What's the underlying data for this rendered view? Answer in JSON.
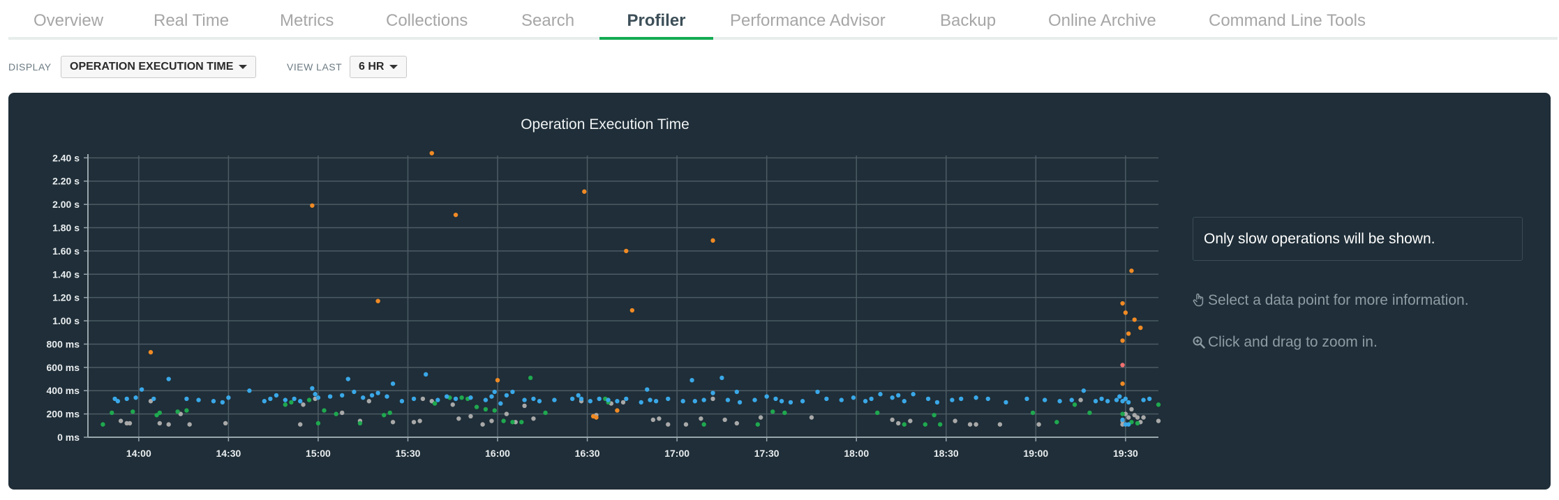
{
  "tabs": [
    {
      "label": "Overview",
      "active": false
    },
    {
      "label": "Real Time",
      "active": false
    },
    {
      "label": "Metrics",
      "active": false
    },
    {
      "label": "Collections",
      "active": false
    },
    {
      "label": "Search",
      "active": false
    },
    {
      "label": "Profiler",
      "active": true
    },
    {
      "label": "Performance Advisor",
      "active": false
    },
    {
      "label": "Backup",
      "active": false
    },
    {
      "label": "Online Archive",
      "active": false
    },
    {
      "label": "Command Line Tools",
      "active": false
    }
  ],
  "controls": {
    "display_label": "DISPLAY",
    "display_value": "OPERATION EXECUTION TIME",
    "view_last_label": "VIEW LAST",
    "view_last_value": "6 HR"
  },
  "info": {
    "message": "Only slow operations will be shown.",
    "hint_select": "Select a data point for more information.",
    "hint_zoom": "Click and drag to zoom in."
  },
  "colors": {
    "accent": "#13aa52",
    "panel_bg": "#1f2e38",
    "blue": "#3aa8e8",
    "orange": "#f08a24",
    "green": "#1fa84f",
    "gray": "#a9a9a9",
    "red": "#f07070"
  },
  "chart_data": {
    "type": "scatter",
    "title": "Operation Execution Time",
    "xlabel": "",
    "ylabel": "",
    "x_ticks": [
      "14:00",
      "14:30",
      "15:00",
      "15:30",
      "16:00",
      "16:30",
      "17:00",
      "17:30",
      "18:00",
      "18:30",
      "19:00",
      "19:30"
    ],
    "y_ticks": [
      "0 ms",
      "200 ms",
      "400 ms",
      "600 ms",
      "800 ms",
      "1.00 s",
      "1.20 s",
      "1.40 s",
      "1.60 s",
      "1.80 s",
      "2.00 s",
      "2.20 s",
      "2.40 s"
    ],
    "xlim": [
      "13:43",
      "19:41"
    ],
    "ylim_ms": [
      0,
      2420
    ],
    "grid": true,
    "series": [
      {
        "color": "orange",
        "points": [
          [
            "14:04",
            730
          ],
          [
            "14:58",
            1990
          ],
          [
            "15:20",
            1170
          ],
          [
            "15:38",
            2440
          ],
          [
            "15:46",
            1910
          ],
          [
            "16:00",
            490
          ],
          [
            "16:29",
            2110
          ],
          [
            "16:32",
            180
          ],
          [
            "16:33",
            170
          ],
          [
            "16:40",
            230
          ],
          [
            "16:43",
            1600
          ],
          [
            "16:45",
            1090
          ],
          [
            "17:12",
            1690
          ],
          [
            "19:29",
            1150
          ],
          [
            "19:29",
            830
          ],
          [
            "19:29",
            460
          ],
          [
            "19:30",
            1070
          ],
          [
            "19:31",
            890
          ],
          [
            "19:32",
            1430
          ],
          [
            "19:33",
            1010
          ],
          [
            "19:35",
            940
          ]
        ]
      },
      {
        "color": "blue",
        "points": [
          [
            "13:52",
            330
          ],
          [
            "13:53",
            310
          ],
          [
            "13:56",
            330
          ],
          [
            "13:59",
            340
          ],
          [
            "14:01",
            410
          ],
          [
            "14:05",
            330
          ],
          [
            "14:10",
            500
          ],
          [
            "14:16",
            330
          ],
          [
            "14:20",
            320
          ],
          [
            "14:25",
            310
          ],
          [
            "14:28",
            300
          ],
          [
            "14:30",
            340
          ],
          [
            "14:37",
            400
          ],
          [
            "14:42",
            310
          ],
          [
            "14:44",
            330
          ],
          [
            "14:46",
            360
          ],
          [
            "14:49",
            320
          ],
          [
            "14:52",
            330
          ],
          [
            "14:54",
            310
          ],
          [
            "14:58",
            420
          ],
          [
            "14:59",
            370
          ],
          [
            "15:00",
            340
          ],
          [
            "15:04",
            350
          ],
          [
            "15:08",
            360
          ],
          [
            "15:10",
            500
          ],
          [
            "15:12",
            390
          ],
          [
            "15:15",
            340
          ],
          [
            "15:18",
            360
          ],
          [
            "15:20",
            380
          ],
          [
            "15:23",
            350
          ],
          [
            "15:25",
            460
          ],
          [
            "15:28",
            310
          ],
          [
            "15:32",
            330
          ],
          [
            "15:36",
            540
          ],
          [
            "15:40",
            320
          ],
          [
            "15:43",
            350
          ],
          [
            "15:46",
            330
          ],
          [
            "15:51",
            340
          ],
          [
            "15:56",
            320
          ],
          [
            "15:58",
            350
          ],
          [
            "15:59",
            390
          ],
          [
            "16:01",
            290
          ],
          [
            "16:03",
            360
          ],
          [
            "16:05",
            390
          ],
          [
            "16:09",
            320
          ],
          [
            "16:12",
            330
          ],
          [
            "16:14",
            310
          ],
          [
            "16:19",
            320
          ],
          [
            "16:25",
            330
          ],
          [
            "16:27",
            360
          ],
          [
            "16:28",
            330
          ],
          [
            "16:31",
            310
          ],
          [
            "16:34",
            330
          ],
          [
            "16:37",
            320
          ],
          [
            "16:40",
            310
          ],
          [
            "16:43",
            330
          ],
          [
            "16:48",
            300
          ],
          [
            "16:50",
            410
          ],
          [
            "16:51",
            320
          ],
          [
            "16:53",
            310
          ],
          [
            "16:57",
            330
          ],
          [
            "17:02",
            310
          ],
          [
            "17:05",
            490
          ],
          [
            "17:06",
            310
          ],
          [
            "17:09",
            320
          ],
          [
            "17:12",
            380
          ],
          [
            "17:15",
            510
          ],
          [
            "17:17",
            320
          ],
          [
            "17:20",
            390
          ],
          [
            "17:21",
            300
          ],
          [
            "17:26",
            320
          ],
          [
            "17:30",
            350
          ],
          [
            "17:33",
            330
          ],
          [
            "17:35",
            310
          ],
          [
            "17:38",
            300
          ],
          [
            "17:42",
            310
          ],
          [
            "17:47",
            390
          ],
          [
            "17:50",
            330
          ],
          [
            "17:55",
            320
          ],
          [
            "17:59",
            340
          ],
          [
            "18:03",
            310
          ],
          [
            "18:05",
            330
          ],
          [
            "18:08",
            370
          ],
          [
            "18:12",
            340
          ],
          [
            "18:14",
            360
          ],
          [
            "18:16",
            310
          ],
          [
            "18:19",
            370
          ],
          [
            "18:24",
            330
          ],
          [
            "18:27",
            300
          ],
          [
            "18:32",
            320
          ],
          [
            "18:35",
            330
          ],
          [
            "18:40",
            340
          ],
          [
            "18:44",
            330
          ],
          [
            "18:50",
            300
          ],
          [
            "18:57",
            330
          ],
          [
            "19:03",
            320
          ],
          [
            "19:08",
            310
          ],
          [
            "19:12",
            320
          ],
          [
            "19:16",
            400
          ],
          [
            "19:20",
            310
          ],
          [
            "19:22",
            330
          ],
          [
            "19:24",
            310
          ],
          [
            "19:27",
            320
          ],
          [
            "19:28",
            350
          ],
          [
            "19:29",
            310
          ],
          [
            "19:30",
            330
          ],
          [
            "19:31",
            300
          ],
          [
            "19:36",
            320
          ],
          [
            "19:38",
            330
          ],
          [
            "19:30",
            110
          ],
          [
            "19:31",
            110
          ],
          [
            "19:29",
            150
          ]
        ]
      },
      {
        "color": "green",
        "points": [
          [
            "13:48",
            110
          ],
          [
            "13:51",
            210
          ],
          [
            "13:58",
            220
          ],
          [
            "14:06",
            190
          ],
          [
            "14:07",
            210
          ],
          [
            "14:13",
            220
          ],
          [
            "14:16",
            230
          ],
          [
            "14:49",
            280
          ],
          [
            "14:51",
            300
          ],
          [
            "14:57",
            320
          ],
          [
            "15:00",
            120
          ],
          [
            "15:02",
            230
          ],
          [
            "15:06",
            200
          ],
          [
            "15:14",
            120
          ],
          [
            "15:22",
            190
          ],
          [
            "15:24",
            210
          ],
          [
            "15:39",
            290
          ],
          [
            "15:44",
            340
          ],
          [
            "15:48",
            340
          ],
          [
            "15:50",
            330
          ],
          [
            "15:53",
            260
          ],
          [
            "15:56",
            240
          ],
          [
            "15:59",
            230
          ],
          [
            "16:02",
            140
          ],
          [
            "16:05",
            130
          ],
          [
            "16:08",
            130
          ],
          [
            "16:11",
            510
          ],
          [
            "16:16",
            210
          ],
          [
            "16:36",
            330
          ],
          [
            "16:37",
            300
          ],
          [
            "17:09",
            110
          ],
          [
            "17:27",
            110
          ],
          [
            "17:32",
            220
          ],
          [
            "17:36",
            210
          ],
          [
            "18:07",
            210
          ],
          [
            "18:16",
            110
          ],
          [
            "18:23",
            110
          ],
          [
            "18:26",
            190
          ],
          [
            "18:28",
            110
          ],
          [
            "18:59",
            210
          ],
          [
            "19:07",
            130
          ],
          [
            "19:13",
            280
          ],
          [
            "19:18",
            210
          ],
          [
            "19:29",
            200
          ],
          [
            "19:32",
            130
          ],
          [
            "19:34",
            120
          ],
          [
            "19:41",
            280
          ]
        ]
      },
      {
        "color": "gray",
        "points": [
          [
            "13:54",
            140
          ],
          [
            "13:56",
            120
          ],
          [
            "13:57",
            120
          ],
          [
            "14:04",
            310
          ],
          [
            "14:07",
            120
          ],
          [
            "14:10",
            110
          ],
          [
            "14:14",
            200
          ],
          [
            "14:17",
            110
          ],
          [
            "14:29",
            120
          ],
          [
            "14:54",
            110
          ],
          [
            "14:55",
            280
          ],
          [
            "14:59",
            330
          ],
          [
            "15:08",
            210
          ],
          [
            "15:14",
            140
          ],
          [
            "15:17",
            310
          ],
          [
            "15:25",
            130
          ],
          [
            "15:32",
            130
          ],
          [
            "15:34",
            140
          ],
          [
            "15:35",
            330
          ],
          [
            "15:38",
            310
          ],
          [
            "15:45",
            280
          ],
          [
            "15:47",
            160
          ],
          [
            "15:51",
            180
          ],
          [
            "15:55",
            110
          ],
          [
            "15:58",
            140
          ],
          [
            "16:03",
            200
          ],
          [
            "16:06",
            130
          ],
          [
            "16:09",
            270
          ],
          [
            "16:12",
            160
          ],
          [
            "16:28",
            310
          ],
          [
            "16:33",
            190
          ],
          [
            "16:38",
            290
          ],
          [
            "16:42",
            300
          ],
          [
            "16:52",
            150
          ],
          [
            "16:54",
            160
          ],
          [
            "16:57",
            110
          ],
          [
            "17:03",
            110
          ],
          [
            "17:08",
            160
          ],
          [
            "17:12",
            330
          ],
          [
            "17:16",
            150
          ],
          [
            "17:20",
            120
          ],
          [
            "17:28",
            170
          ],
          [
            "17:45",
            170
          ],
          [
            "18:12",
            150
          ],
          [
            "18:14",
            120
          ],
          [
            "18:18",
            140
          ],
          [
            "18:33",
            140
          ],
          [
            "18:38",
            110
          ],
          [
            "18:40",
            110
          ],
          [
            "18:48",
            110
          ],
          [
            "19:01",
            110
          ],
          [
            "19:15",
            320
          ],
          [
            "19:29",
            110
          ],
          [
            "19:29",
            140
          ],
          [
            "19:30",
            200
          ],
          [
            "19:31",
            170
          ],
          [
            "19:32",
            240
          ],
          [
            "19:33",
            190
          ],
          [
            "19:34",
            170
          ],
          [
            "19:35",
            130
          ],
          [
            "19:36",
            170
          ],
          [
            "19:41",
            140
          ]
        ]
      },
      {
        "color": "red",
        "points": [
          [
            "19:29",
            620
          ]
        ]
      }
    ]
  }
}
